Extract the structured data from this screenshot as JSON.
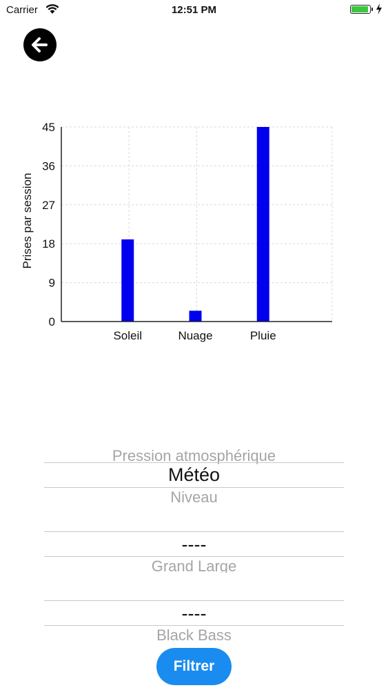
{
  "status_bar": {
    "carrier": "Carrier",
    "time": "12:51 PM"
  },
  "chart_data": {
    "type": "bar",
    "categories": [
      "Soleil",
      "Nuage",
      "Pluie"
    ],
    "values": [
      19,
      2.5,
      45
    ],
    "ylabel": "Prises par session",
    "xlabel": "",
    "ylim": [
      0,
      45
    ],
    "yticks": [
      0,
      9,
      18,
      27,
      36,
      45
    ],
    "grid": true,
    "bar_color": "#0000ee"
  },
  "pickers": [
    {
      "above": "Pression atmosphérique",
      "selected": "Météo",
      "below": "Niveau"
    },
    {
      "above": "",
      "selected": "----",
      "below": "Grand Large"
    },
    {
      "above": "",
      "selected": "----",
      "below": "Black Bass"
    }
  ],
  "filter_button": {
    "label": "Filtrer",
    "color": "#1a8cf0"
  }
}
